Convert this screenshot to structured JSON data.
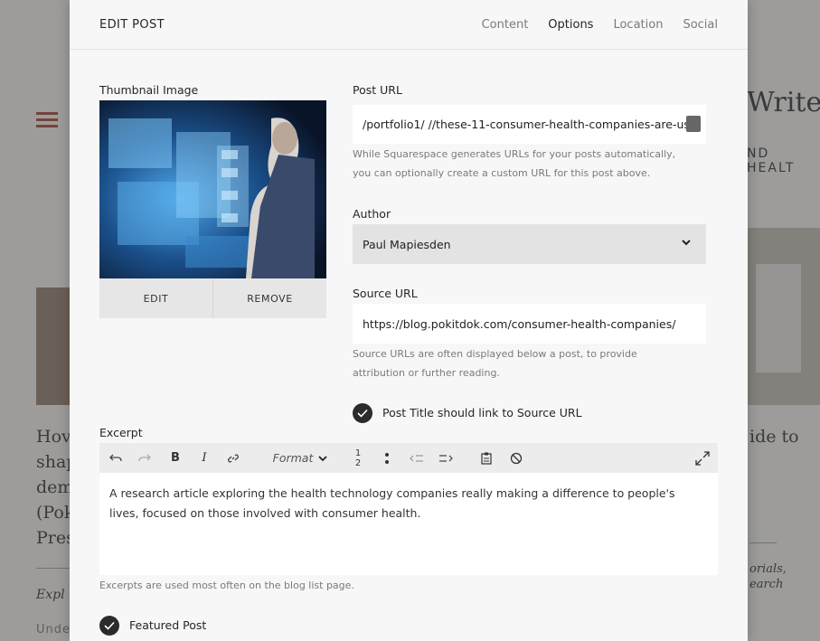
{
  "background": {
    "site_title_fragment": "Writer",
    "site_tagline_fragment": "ND HEALT",
    "left_post_lines": [
      "Hov",
      "shap",
      "dem",
      "(Pok",
      "Pres"
    ],
    "left_post_excerpt": "Expl",
    "left_post_meta": "Unde",
    "right_post_title": "ide to",
    "right_post_excerpt": [
      "orials,",
      "earch"
    ]
  },
  "modal": {
    "title": "EDIT POST",
    "tabs": [
      {
        "label": "Content",
        "active": false
      },
      {
        "label": "Options",
        "active": true
      },
      {
        "label": "Location",
        "active": false
      },
      {
        "label": "Social",
        "active": false
      }
    ],
    "thumbnail": {
      "label": "Thumbnail Image",
      "edit_label": "EDIT",
      "remove_label": "REMOVE"
    },
    "post_url": {
      "label": "Post URL",
      "value": "/portfolio1/ //these-11-consumer-health-companies-are-us",
      "help_line1": "While Squarespace generates URLs for your posts automatically,",
      "help_line2": "you can optionally create a custom URL for this post above."
    },
    "author": {
      "label": "Author",
      "value": "Paul Mapiesden"
    },
    "source_url": {
      "label": "Source URL",
      "value": "https://blog.pokitdok.com/consumer-health-companies/",
      "help_line1": "Source URLs are often displayed below a post, to provide",
      "help_line2": "attribution or further reading.",
      "link_title_label": "Post Title should link to Source URL",
      "link_title_checked": true
    },
    "excerpt": {
      "label": "Excerpt",
      "format_label": "Format",
      "body_line1": "A research article exploring the health technology companies really making a difference to people's",
      "body_line2": "lives, focused on those involved with consumer health.",
      "help": "Excerpts are used most often on the blog list page."
    },
    "featured": {
      "label": "Featured Post",
      "checked": true
    }
  }
}
